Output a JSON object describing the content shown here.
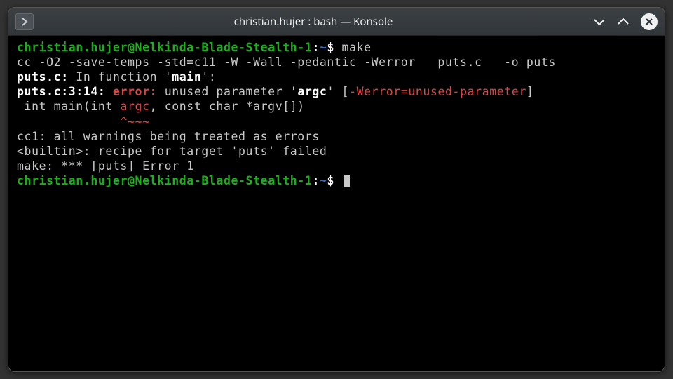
{
  "window": {
    "title": "christian.hujer : bash — Konsole"
  },
  "prompt": {
    "userhost": "christian.hujer@Nelkinda-Blade-Stealth-1",
    "colon": ":",
    "path": "~",
    "dollar": "$ "
  },
  "lines": {
    "cmd1": "make",
    "l1": "cc -O2 -save-temps -std=c11 -W -Wall -pedantic -Werror   puts.c   -o puts",
    "l2a": "puts.c:",
    "l2b": " In function '",
    "l2c": "main",
    "l2d": "':",
    "l3a": "puts.c:3:14: ",
    "l3b": "error:",
    "l3c": " unused parameter '",
    "l3d": "argc",
    "l3e": "' [",
    "l3f": "-Werror=unused-parameter",
    "l3g": "]",
    "l4a": " int main(int ",
    "l4b": "argc",
    "l4c": ", const char *argv[])",
    "l5a": "              ",
    "l5b": "^~~~",
    "l6": "cc1: all warnings being treated as errors",
    "l7": "<builtin>: recipe for target 'puts' failed",
    "l8": "make: *** [puts] Error 1"
  },
  "colors": {
    "prompt_green": "#18b218",
    "prompt_blue": "#1e6dd8",
    "error_red": "#d44",
    "bold_white": "#ffffff",
    "fg": "#c8c8c8",
    "bg": "#000000"
  }
}
